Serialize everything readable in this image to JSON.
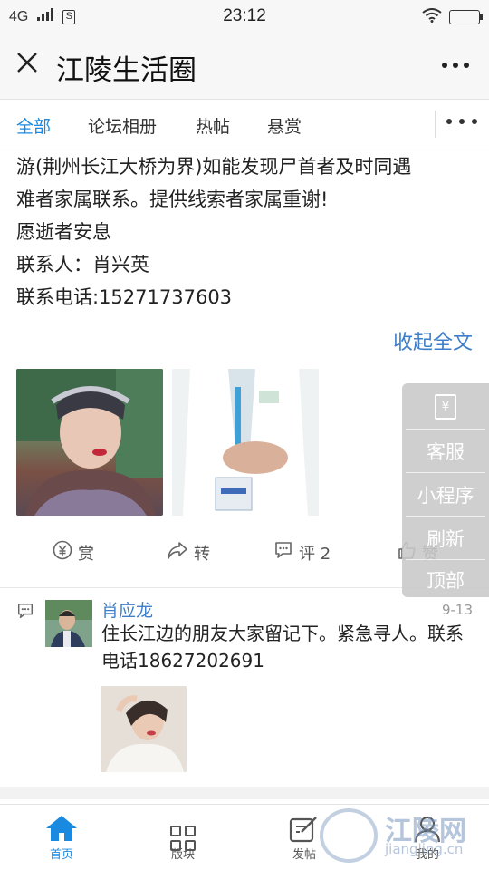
{
  "status_bar": {
    "network": "4G",
    "time": "23:12"
  },
  "header": {
    "title": "江陵生活圈",
    "close_icon": "close-icon",
    "more_icon": "more-icon"
  },
  "tabs": {
    "items": [
      {
        "label": "全部",
        "active": true
      },
      {
        "label": "论坛相册",
        "active": false
      },
      {
        "label": "热帖",
        "active": false
      },
      {
        "label": "悬赏",
        "active": false
      }
    ],
    "more_icon": "more-icon"
  },
  "post": {
    "lines": [
      "游(荆州长江大桥为界)如能发现尸首者及时同遇",
      "难者家属联系。提供线索者家属重谢!",
      "愿逝者安息",
      "联系人：肖兴英",
      "联系电话:15271737603"
    ],
    "collapse_label": "收起全文",
    "actions": {
      "reward": "赏",
      "share": "转",
      "comment": "评 2",
      "like": "赞"
    }
  },
  "comment": {
    "name": "肖应龙",
    "date": "9-13",
    "text": "住长江边的朋友大家留记下。紧急寻人。联系电话18627202691"
  },
  "side_panel": {
    "items": [
      "客服",
      "小程序",
      "刷新",
      "顶部"
    ]
  },
  "bottom_nav": {
    "items": [
      {
        "label": "首页",
        "icon": "home-icon",
        "active": true
      },
      {
        "label": "版块",
        "icon": "grid-icon",
        "active": false
      },
      {
        "label": "发帖",
        "icon": "compose-icon",
        "active": false
      },
      {
        "label": "我的",
        "icon": "profile-icon",
        "active": false
      }
    ]
  },
  "watermark": {
    "name": "江陵网",
    "domain": "jiangling.cn"
  },
  "colors": {
    "accent": "#1a8ae0",
    "link": "#3f7fc9"
  }
}
